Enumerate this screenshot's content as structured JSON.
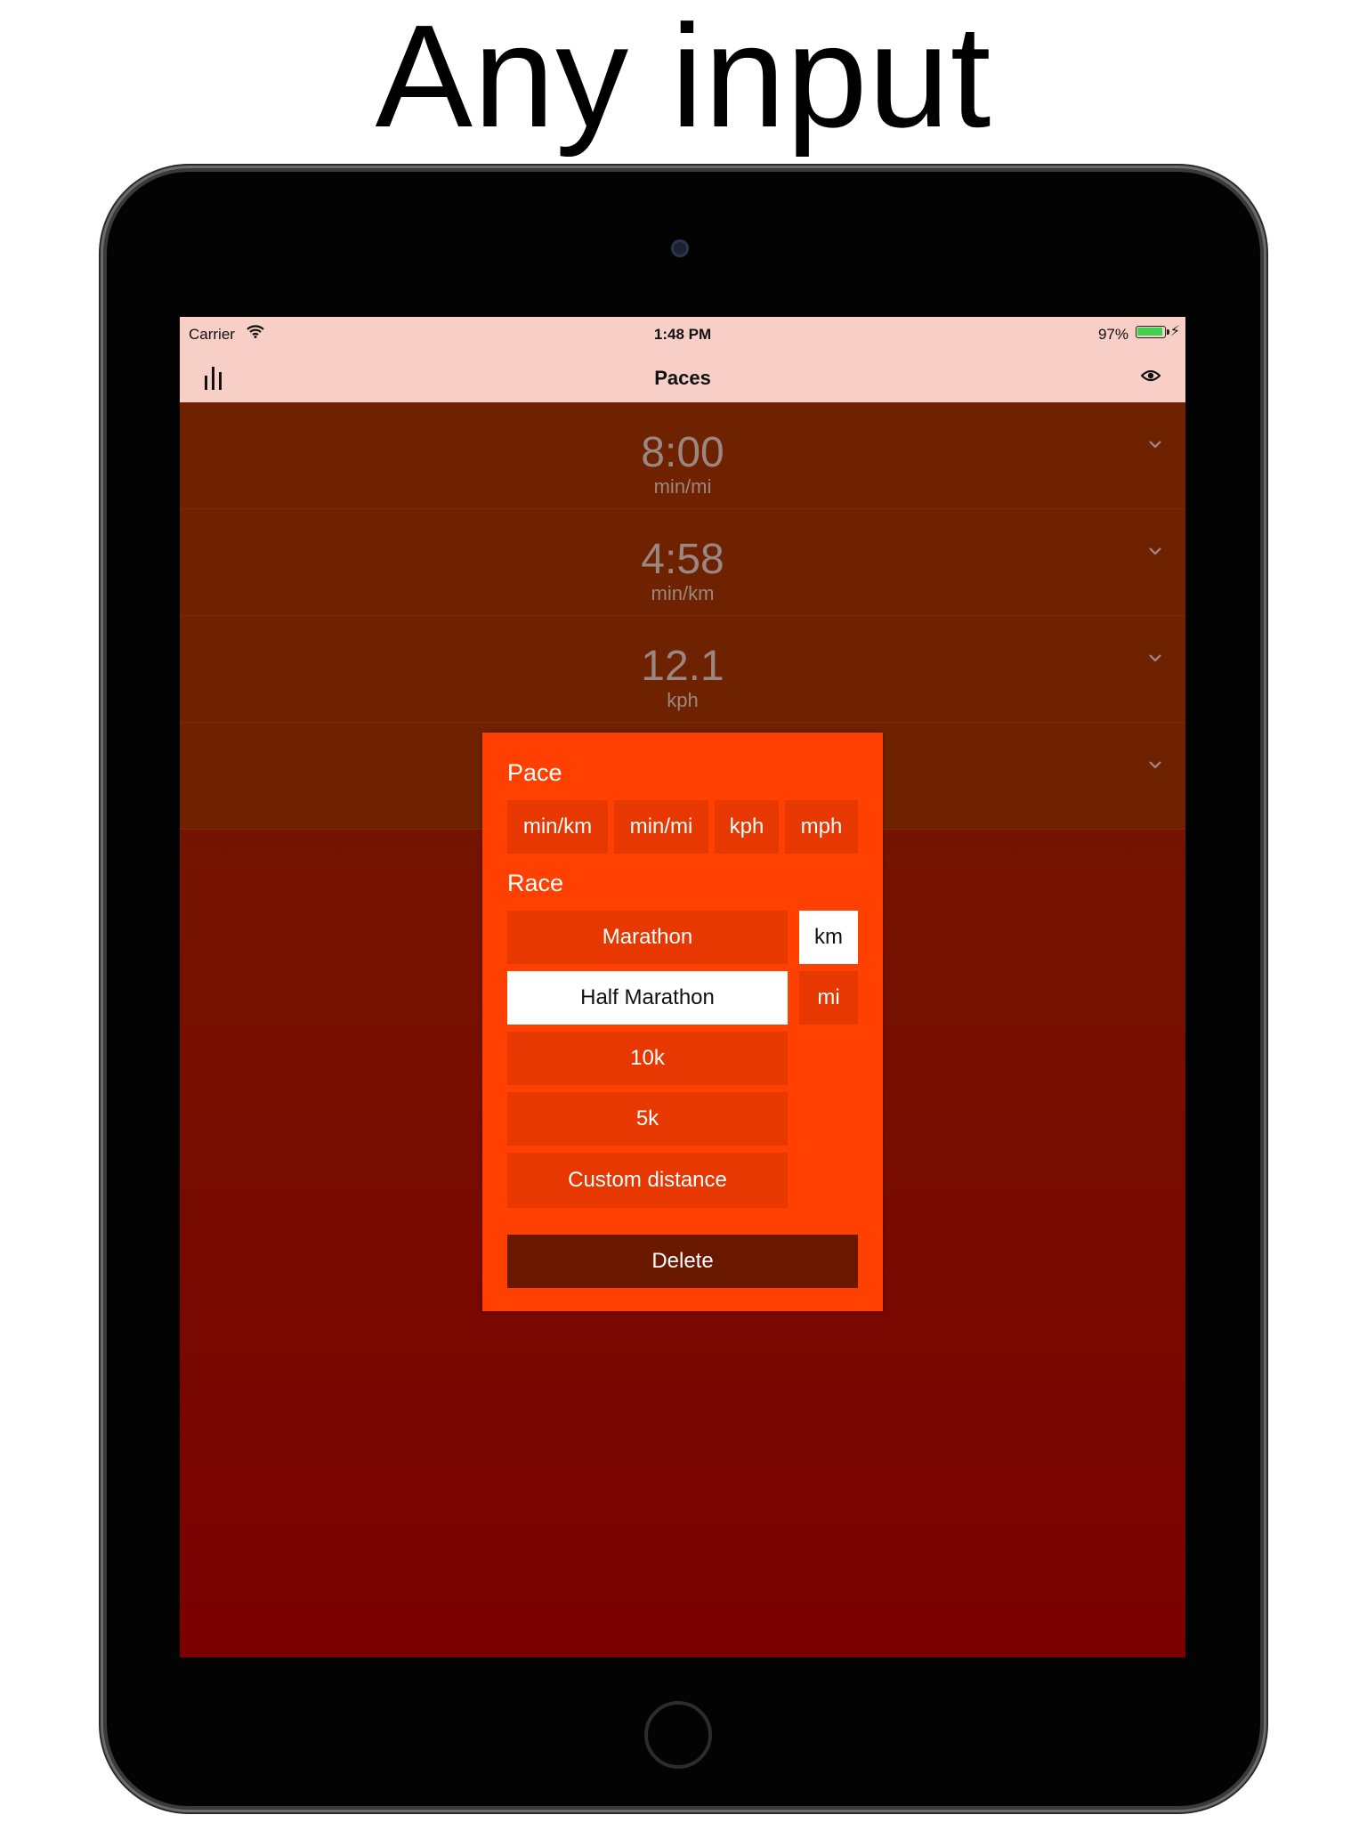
{
  "headline": "Any input",
  "status_bar": {
    "carrier": "Carrier",
    "time": "1:48 PM",
    "battery": "97%",
    "battery_level": 0.97,
    "battery_color": "#3fd04f"
  },
  "nav": {
    "title": "Paces",
    "left_icon": "bar-chart-icon",
    "right_icon": "eye-icon"
  },
  "rows": [
    {
      "value": "8:00",
      "unit": "min/mi"
    },
    {
      "value": "4:58",
      "unit": "min/km"
    },
    {
      "value": "12.1",
      "unit": "kph"
    },
    {
      "value": "",
      "unit": ""
    }
  ],
  "popup": {
    "pace_title": "Pace",
    "pace_buttons": [
      "min/km",
      "min/mi",
      "kph",
      "mph"
    ],
    "race_title": "Race",
    "race_buttons": [
      "Marathon",
      "Half Marathon",
      "10k",
      "5k",
      "Custom distance"
    ],
    "race_selected": "Half Marathon",
    "unit_buttons": [
      "km",
      "mi"
    ],
    "unit_selected": "km",
    "delete_label": "Delete"
  },
  "colors": {
    "nav_background": "#f8cfc6",
    "popup_background": "#ff4000",
    "button_background": "#e63800",
    "delete_background": "#6b1800",
    "row_background": "#6e2200"
  }
}
